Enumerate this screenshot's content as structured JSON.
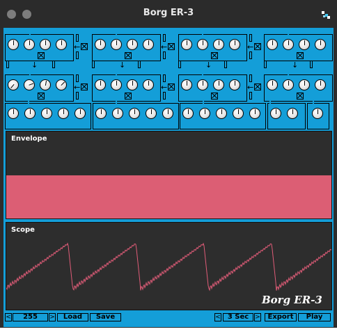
{
  "window": {
    "title": "Borg ER-3",
    "app_icon": "app-icon"
  },
  "osc_top_row": [
    {
      "name": "OSC5",
      "knobs": [
        "F",
        "A",
        "R",
        "T"
      ]
    },
    {
      "name": "OSC6",
      "knobs": [
        "F",
        "A",
        "R",
        "T"
      ]
    },
    {
      "name": "OSC7",
      "knobs": [
        "F",
        "A",
        "R",
        "T"
      ]
    },
    {
      "name": "OSC8",
      "knobs": [
        "F",
        "A",
        "R",
        "T"
      ]
    }
  ],
  "osc_mid_row": [
    {
      "name": "MSTR",
      "knobs": [
        "F",
        "A",
        "R",
        "T"
      ]
    },
    {
      "name": "OSC2",
      "knobs": [
        "F",
        "A",
        "R",
        "T"
      ]
    },
    {
      "name": "OSC3",
      "knobs": [
        "F",
        "A",
        "R",
        "T"
      ]
    },
    {
      "name": "OSC4",
      "knobs": [
        "F",
        "A",
        "R",
        "T"
      ]
    }
  ],
  "mod_labels": {
    "am": "AM",
    "fm": "FM"
  },
  "filter_row": [
    {
      "name": "BIQUAD1",
      "knobs": [
        "B",
        "B",
        "B",
        "A",
        "A"
      ]
    },
    {
      "name": "BIQUAD2",
      "knobs": [
        "B",
        "B",
        "B",
        "A",
        "A"
      ]
    },
    {
      "name": "BIQUAD3",
      "knobs": [
        "B",
        "B",
        "B",
        "A",
        "A"
      ]
    },
    {
      "name": "OFFSET",
      "knobs": [
        "F",
        "A"
      ]
    },
    {
      "name": "CR",
      "knobs": [
        ""
      ]
    }
  ],
  "envelope": {
    "title": "Envelope",
    "fill_color": "#dc5e74",
    "level": 0.55
  },
  "scope": {
    "title": "Scope",
    "line_color": "#e05c78",
    "brand": "Borg ER-3"
  },
  "footer": {
    "preset_value": "255",
    "load_label": "Load",
    "save_label": "Save",
    "duration_value": "3 Sec",
    "export_label": "Export",
    "play_label": "Play",
    "prev_glyph": "<",
    "next_glyph": ">"
  },
  "colors": {
    "panel": "#149ed8",
    "display_bg": "#2d2d2d",
    "titlebar": "#2b2b2b"
  }
}
